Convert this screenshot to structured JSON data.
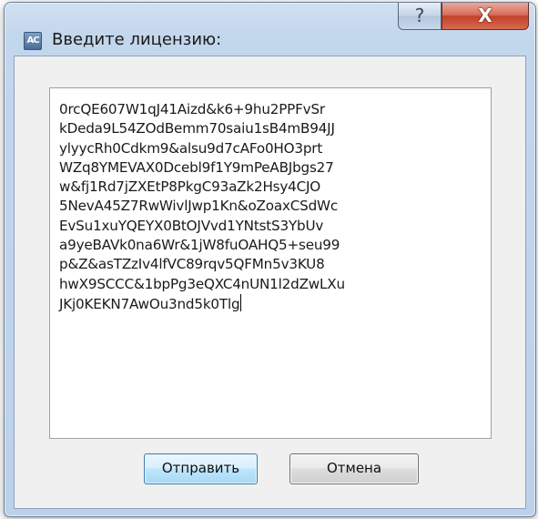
{
  "window": {
    "title": "Введите лицензию:",
    "app_icon_text": "AC",
    "help_glyph": "?",
    "close_glyph": "X"
  },
  "license_input": {
    "lines": [
      "0rcQE607W1qJ41Aizd&k6+9hu2PPFvSr",
      "kDeda9L54ZOdBemm70saiu1sB4mB94JJ",
      "ylyycRh0Cdkm9&alsu9d7cAFo0HO3prt",
      "WZq8YMEVAX0Dcebl9f1Y9mPeABJbgs27",
      "w&fj1Rd7jZXEtP8PkgC93aZk2Hsy4CJO",
      "5NevA45Z7RwWivlJwp1Kn&oZoaxCSdWc",
      "EvSu1xuYQEYX0BtOJVvd1YNtstS3YbUv",
      "a9yeBAVk0na6Wr&1jW8fuOAHQ5+seu99",
      "p&Z&asTZzIv4lfVC89rqv5QFMn5v3KU8",
      "hwX9SCCC&1bpPg3eQXC4nUN1l2dZwLXu",
      "JKj0KEKN7AwOu3nd5k0Tlg"
    ]
  },
  "buttons": {
    "send_label": "Отправить",
    "cancel_label": "Отмена"
  }
}
